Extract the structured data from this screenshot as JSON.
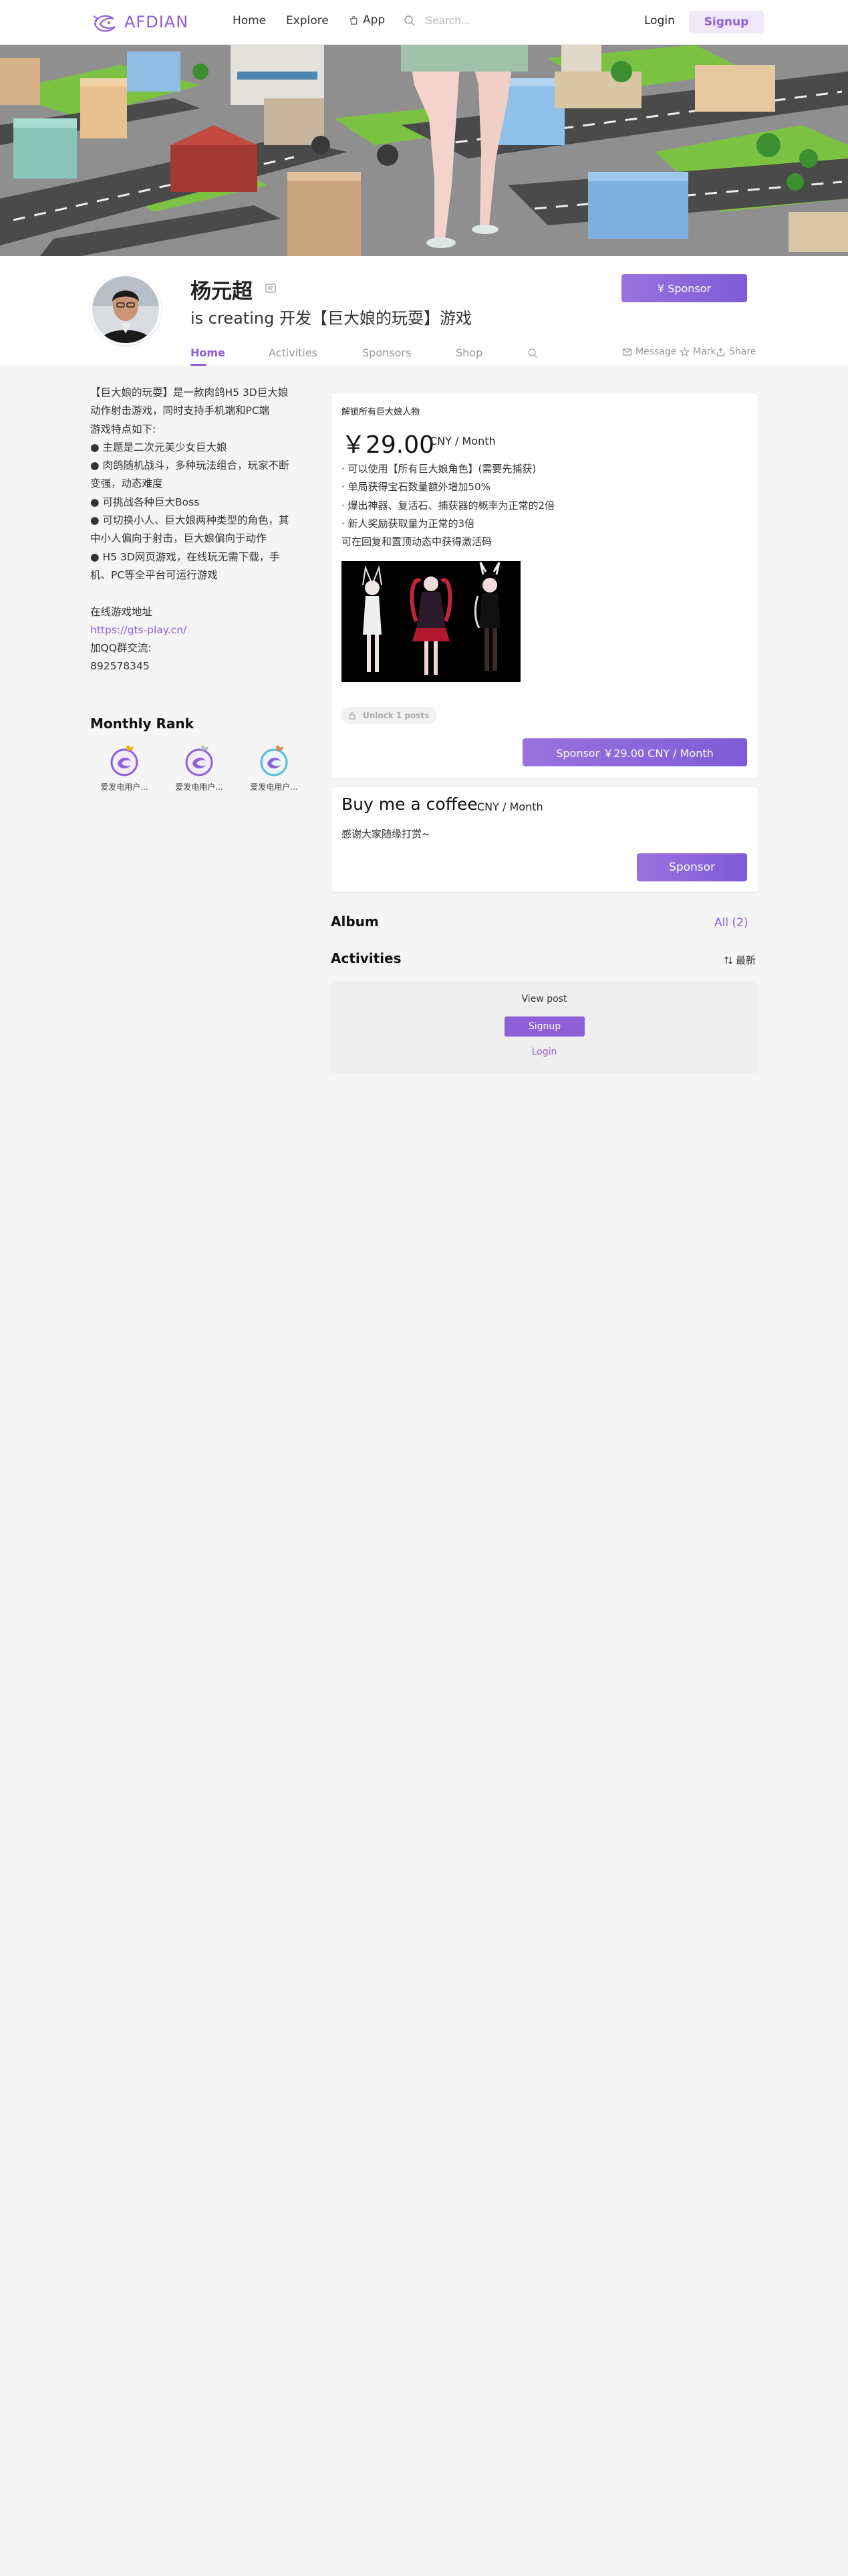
{
  "nav": {
    "brand": "AFDIAN",
    "home": "Home",
    "explore": "Explore",
    "app": "App",
    "search_placeholder": "Search...",
    "login": "Login",
    "signup": "Signup"
  },
  "profile": {
    "name": "杨元超",
    "description": "is creating 开发【巨大娘的玩耍】游戏",
    "sponsor_button": "¥  Sponsor",
    "tabs": [
      "Home",
      "Activities",
      "Sponsors",
      "Shop"
    ],
    "actions": [
      "Message",
      "Mark",
      "Share"
    ]
  },
  "bio": {
    "lines": [
      "【巨大娘的玩耍】是一款肉鸽H5 3D巨大娘",
      "动作射击游戏，同时支持手机端和PC端",
      "游戏特点如下:",
      "● 主题是二次元美少女巨大娘",
      "● 肉鸽随机战斗，多种玩法组合，玩家不断",
      "变强，动态难度",
      "● 可挑战各种巨大Boss",
      "● 可切换小人、巨大娘两种类型的角色，其",
      "中小人偏向于射击，巨大娘偏向于动作",
      "● H5 3D网页游戏，在线玩无需下载，手",
      "机、PC等全平台可运行游戏",
      "",
      "在线游戏地址"
    ],
    "link": "https://gts-play.cn/",
    "qq_label": "加QQ群交流:",
    "qq_number": "892578345"
  },
  "monthly_rank": {
    "title": "Monthly Rank",
    "users": [
      "爱发电用户...",
      "爱发电用户...",
      "爱发电用户..."
    ]
  },
  "tier": {
    "title": "解锁所有巨大娘人物",
    "price": "￥29.00",
    "unit": "CNY / Month",
    "perks": [
      "· 可以使用【所有巨大娘角色】(需要先捕获)",
      "· 单局获得宝石数量额外增加50%",
      "· 爆出神器、复活石、捕获器的概率为正常的2倍",
      "· 新人奖励获取量为正常的3倍",
      "可在回复和置顶动态中获得激活码"
    ],
    "unlock_label": "Unlock 1 posts",
    "sponsor_button": "Sponsor  ￥29.00 CNY / Month"
  },
  "coffee": {
    "title": "Buy me a coffee",
    "unit": "CNY / Month",
    "description": "感谢大家随缘打赏~",
    "button": "Sponsor"
  },
  "album": {
    "title": "Album",
    "all_label": "All  (2)"
  },
  "activities": {
    "title": "Activities",
    "sort_label": "最新",
    "locked_text": "View post",
    "signup": "Signup",
    "login": "Login"
  },
  "colors": {
    "brand_purple": "#8e5fd8",
    "button_gradient_start": "#9a73e0",
    "button_gradient_end": "#7f5bd6",
    "page_background": "#f5f5f5"
  },
  "icons": {
    "logo": "afdian-fish-logo",
    "app": "shopping-bag-icon",
    "search": "search-icon",
    "verify": "verified-icon",
    "message": "envelope-icon",
    "mark": "star-icon",
    "share": "share-icon",
    "unlock": "lock-icon",
    "sort": "sort-icon"
  }
}
